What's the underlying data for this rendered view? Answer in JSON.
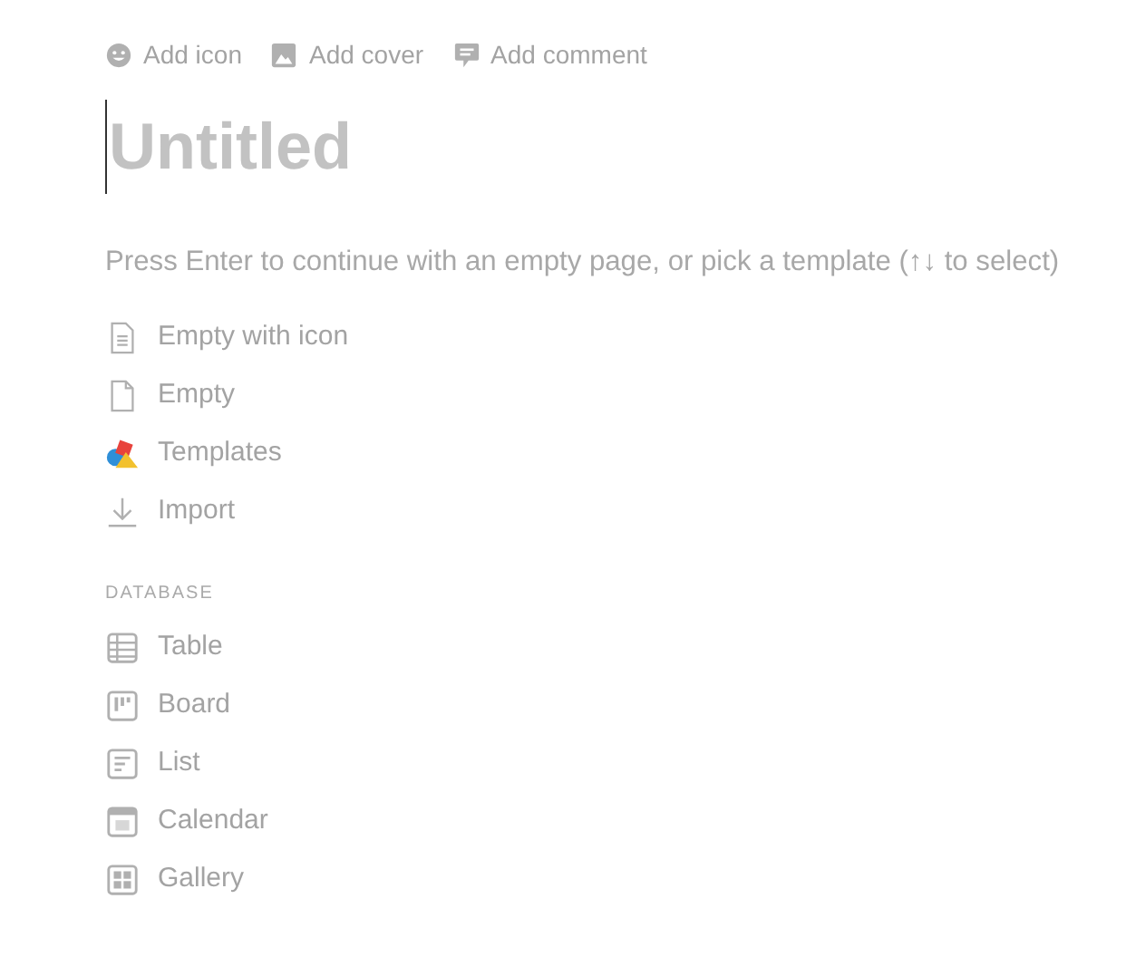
{
  "page_actions": [
    {
      "kind": "emoji",
      "label": "Add icon"
    },
    {
      "kind": "image",
      "label": "Add cover"
    },
    {
      "kind": "comment",
      "label": "Add comment"
    }
  ],
  "title": {
    "placeholder": "Untitled"
  },
  "hint": "Press Enter to continue with an empty page, or pick a template (↑↓ to select)",
  "options": [
    {
      "kind": "doc-lines",
      "label": "Empty with icon"
    },
    {
      "kind": "doc",
      "label": "Empty"
    },
    {
      "kind": "templates",
      "label": "Templates"
    },
    {
      "kind": "import",
      "label": "Import"
    }
  ],
  "database": {
    "heading": "DATABASE",
    "items": [
      {
        "kind": "table",
        "label": "Table"
      },
      {
        "kind": "board",
        "label": "Board"
      },
      {
        "kind": "list",
        "label": "List"
      },
      {
        "kind": "calendar",
        "label": "Calendar"
      },
      {
        "kind": "gallery",
        "label": "Gallery"
      }
    ]
  }
}
